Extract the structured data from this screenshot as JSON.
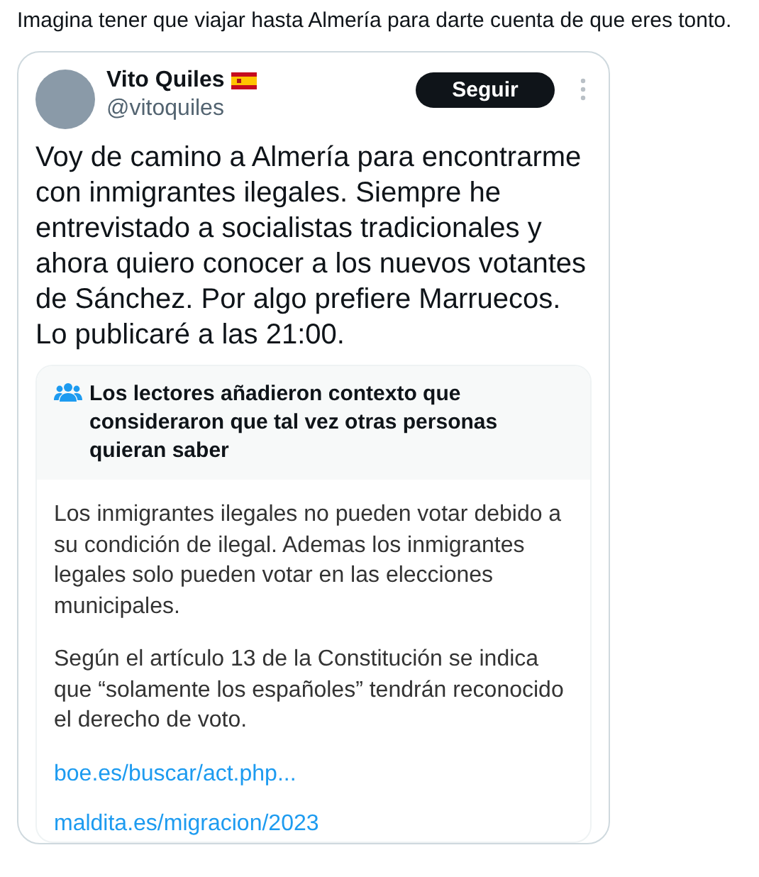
{
  "post_text": "Imagina tener que viajar hasta Almería para darte cuenta de que eres tonto.",
  "quoted_tweet": {
    "author_name": "Vito Quiles",
    "handle": "@vitoquiles",
    "follow_button": "Seguir",
    "text": "Voy de camino a Almería para encontrarme con inmigrantes ilegales. Siempre he entrevistado a socialistas tradicionales y ahora quiero conocer a los nuevos votantes de Sánchez. Por algo prefiere Marruecos. Lo publicaré a las 21:00.",
    "community_note": {
      "title": "Los lectores añadieron contexto que consideraron que tal vez otras personas quieran saber",
      "paragraphs": [
        "Los inmigrantes ilegales no pueden votar debido a su condición de ilegal.  Ademas los inmigrantes legales solo pueden votar en las elecciones municipales.",
        "Según el artículo 13 de la Constitución se indica que “solamente los españoles” tendrán reconocido el derecho de voto."
      ],
      "links": [
        "boe.es/buscar/act.php...",
        "maldita.es/migracion/2023"
      ]
    }
  }
}
